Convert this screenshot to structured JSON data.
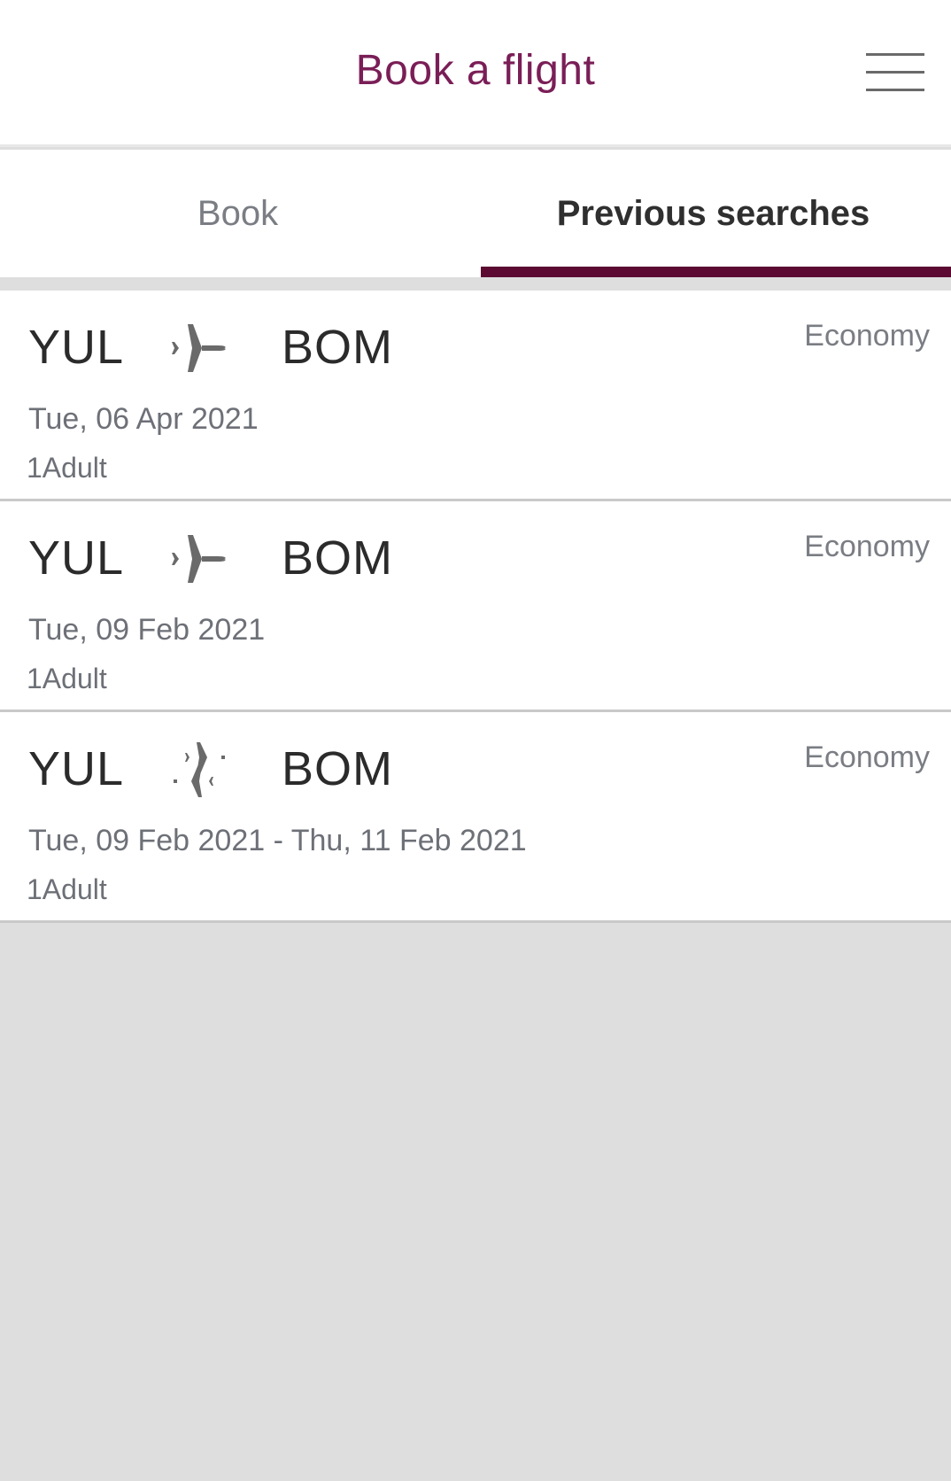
{
  "header": {
    "title": "Book a flight",
    "menu_icon": "hamburger-menu-icon"
  },
  "tabs": [
    {
      "label": "Book",
      "active": false
    },
    {
      "label": "Previous searches",
      "active": true
    }
  ],
  "accent_color": "#5c0a32",
  "title_color": "#7a1e57",
  "searches": [
    {
      "origin": "YUL",
      "destination": "BOM",
      "trip_icon": "one-way-plane-icon",
      "cabin": "Economy",
      "dates": "Tue, 06 Apr 2021",
      "passengers": "1Adult"
    },
    {
      "origin": "YUL",
      "destination": "BOM",
      "trip_icon": "one-way-plane-icon",
      "cabin": "Economy",
      "dates": "Tue, 09 Feb 2021",
      "passengers": "1Adult"
    },
    {
      "origin": "YUL",
      "destination": "BOM",
      "trip_icon": "round-trip-planes-icon",
      "cabin": "Economy",
      "dates": "Tue, 09 Feb 2021 - Thu, 11 Feb 2021",
      "passengers": "1Adult"
    }
  ]
}
